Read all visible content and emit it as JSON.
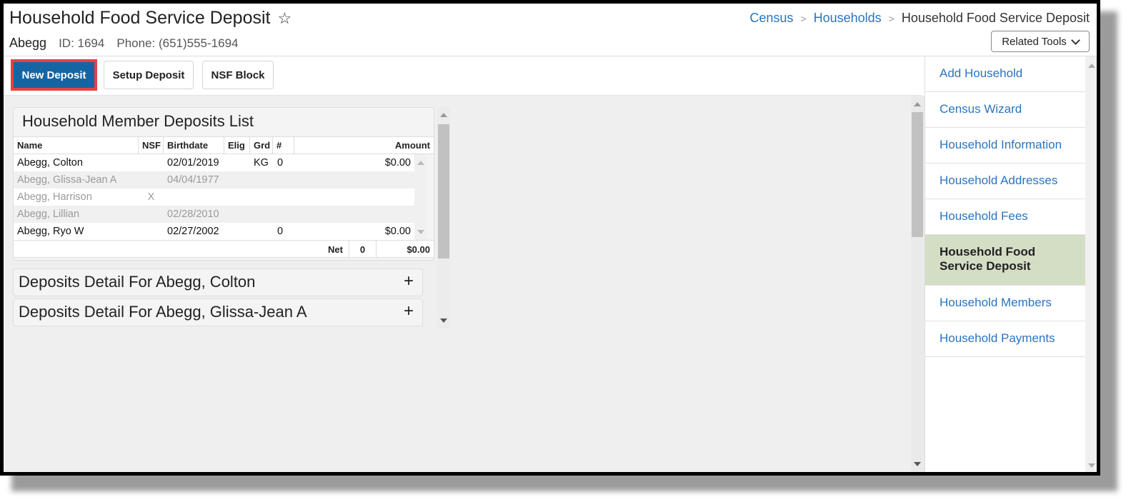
{
  "header": {
    "title": "Household Food Service Deposit",
    "household_name": "Abegg",
    "id_text": "ID: 1694",
    "phone_text": "Phone: (651)555-1694",
    "favorite_icon": "star-outline-icon"
  },
  "breadcrumb": [
    {
      "label": "Census",
      "link": true
    },
    {
      "label": "Households",
      "link": true
    },
    {
      "label": "Household Food Service Deposit",
      "link": false
    }
  ],
  "related_tools": {
    "label": "Related Tools",
    "icon": "chevron-down-icon"
  },
  "toolbar": {
    "new_deposit": "New Deposit",
    "setup_deposit": "Setup Deposit",
    "nsf_block": "NSF Block"
  },
  "deposits_list": {
    "title": "Household Member Deposits List",
    "columns": [
      "Name",
      "NSF",
      "Birthdate",
      "Elig",
      "Grd",
      "#",
      "Amount"
    ],
    "rows": [
      {
        "name": "Abegg, Colton",
        "nsf": "",
        "birthdate": "02/01/2019",
        "elig": "",
        "grd": "KG",
        "count": "0",
        "amount": "$0.00",
        "active": true
      },
      {
        "name": "Abegg, Glissa-Jean A",
        "nsf": "",
        "birthdate": "04/04/1977",
        "elig": "",
        "grd": "",
        "count": "",
        "amount": "",
        "active": false
      },
      {
        "name": "Abegg, Harrison",
        "nsf": "X",
        "birthdate": "",
        "elig": "",
        "grd": "",
        "count": "",
        "amount": "",
        "active": false
      },
      {
        "name": "Abegg, Lillian",
        "nsf": "",
        "birthdate": "02/28/2010",
        "elig": "",
        "grd": "",
        "count": "",
        "amount": "",
        "active": false
      },
      {
        "name": "Abegg, Ryo W",
        "nsf": "",
        "birthdate": "02/27/2002",
        "elig": "",
        "grd": "",
        "count": "0",
        "amount": "$0.00",
        "active": true
      }
    ],
    "footer": {
      "label": "Net",
      "count": "0",
      "amount": "$0.00"
    }
  },
  "details": [
    {
      "title": "Deposits Detail For Abegg, Colton",
      "icon": "plus-icon"
    },
    {
      "title": "Deposits Detail For Abegg, Glissa-Jean A",
      "icon": "plus-icon"
    }
  ],
  "right_nav": {
    "items": [
      {
        "label": "Add Household",
        "selected": false
      },
      {
        "label": "Census Wizard",
        "selected": false
      },
      {
        "label": "Household Information",
        "selected": false
      },
      {
        "label": "Household Addresses",
        "selected": false
      },
      {
        "label": "Household Fees",
        "selected": false
      },
      {
        "label": "Household Food Service Deposit",
        "selected": true
      },
      {
        "label": "Household Members",
        "selected": false
      },
      {
        "label": "Household Payments",
        "selected": false
      }
    ]
  },
  "colors": {
    "primary_button": "#1565a3",
    "highlight_border": "#e84040",
    "link": "#2a74c0",
    "nav_selected_bg": "#d4dec5"
  }
}
